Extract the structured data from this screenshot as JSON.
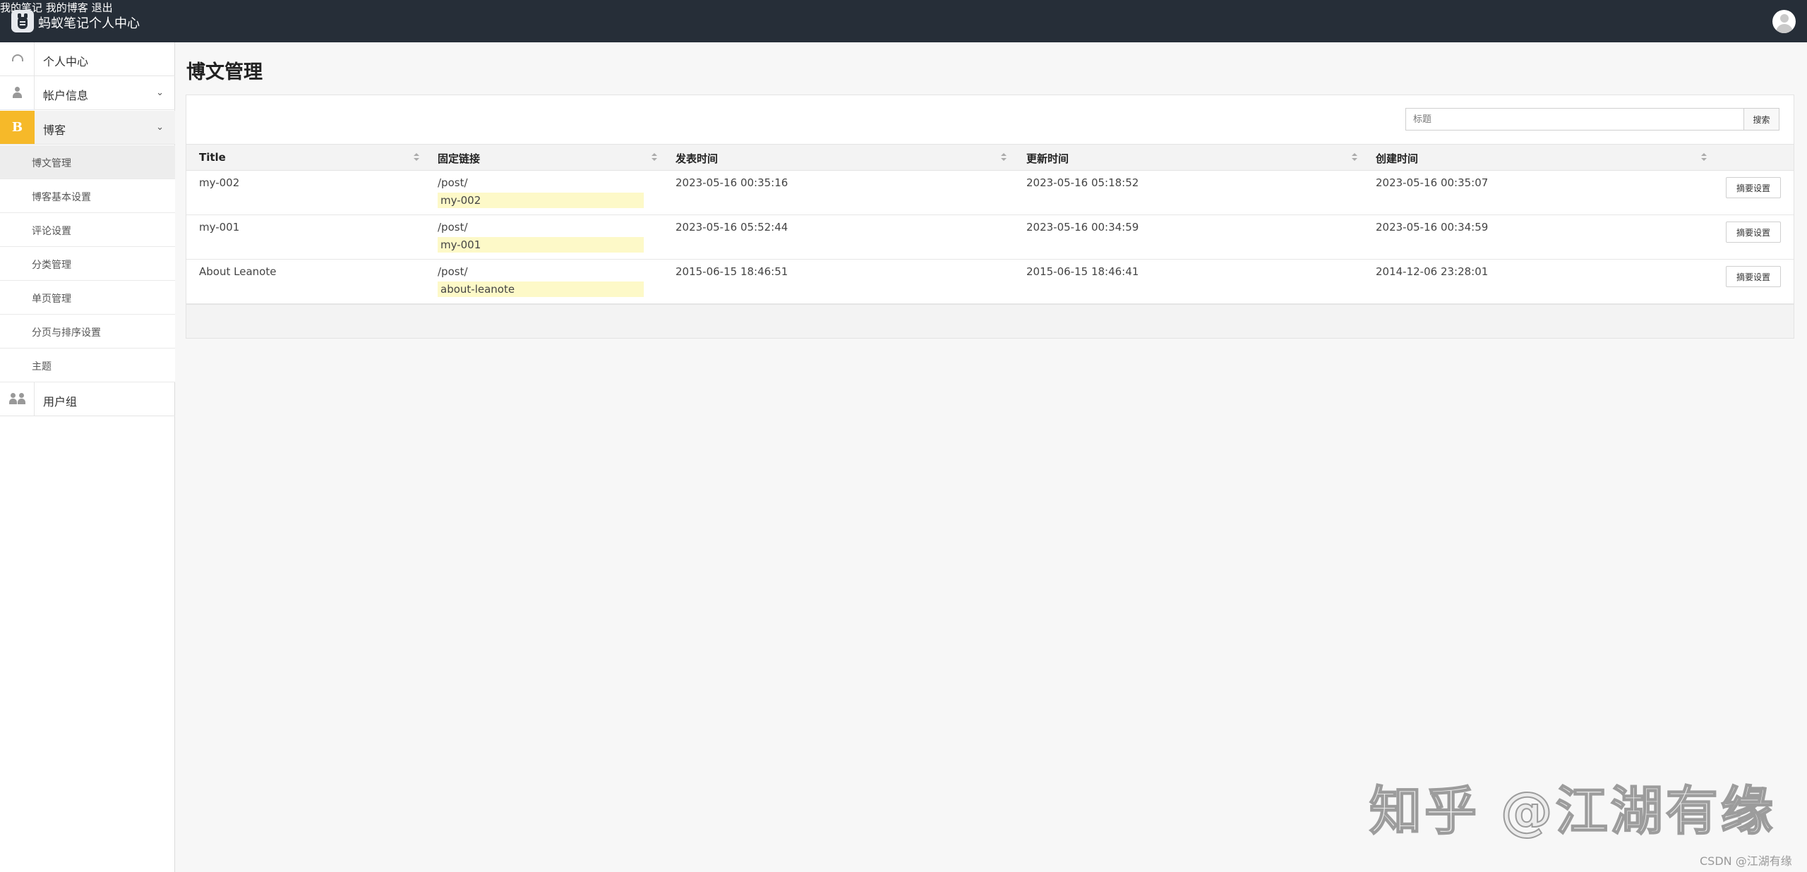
{
  "app": {
    "title": "蚂蚁笔记个人中心"
  },
  "topnav": {
    "my_notes": "我的笔记",
    "my_blog": "我的博客",
    "logout": "退出"
  },
  "sidebar": {
    "items": [
      {
        "label": "个人中心",
        "icon": "dashboard-icon"
      },
      {
        "label": "帐户信息",
        "icon": "user-icon"
      },
      {
        "label": "博客",
        "icon": "blog-icon",
        "icon_text": "B"
      },
      {
        "label": "用户组",
        "icon": "group-icon"
      }
    ],
    "sub_items": [
      {
        "label": "博文管理"
      },
      {
        "label": "博客基本设置"
      },
      {
        "label": "评论设置"
      },
      {
        "label": "分类管理"
      },
      {
        "label": "单页管理"
      },
      {
        "label": "分页与排序设置"
      },
      {
        "label": "主题"
      }
    ],
    "accent_color": "#f6b929"
  },
  "main": {
    "title": "博文管理",
    "search": {
      "placeholder": "标题",
      "button": "搜索"
    },
    "table": {
      "columns": [
        "Title",
        "固定链接",
        "发表时间",
        "更新时间",
        "创建时间"
      ],
      "rows": [
        {
          "title": "my-002",
          "link_prefix": "/post/",
          "slug": "my-002",
          "published": "2023-05-16 00:35:16",
          "updated": "2023-05-16 05:18:52",
          "created": "2023-05-16 00:35:07",
          "action": "摘要设置"
        },
        {
          "title": "my-001",
          "link_prefix": "/post/",
          "slug": "my-001",
          "published": "2023-05-16 05:52:44",
          "updated": "2023-05-16 00:34:59",
          "created": "2023-05-16 00:34:59",
          "action": "摘要设置"
        },
        {
          "title": "About Leanote",
          "link_prefix": "/post/",
          "slug": "about-leanote",
          "published": "2015-06-15 18:46:51",
          "updated": "2015-06-15 18:46:41",
          "created": "2014-12-06 23:28:01",
          "action": "摘要设置"
        }
      ]
    }
  },
  "watermarks": {
    "zhihu": "知乎 @江湖有缘",
    "csdn": "CSDN @江湖有缘"
  }
}
